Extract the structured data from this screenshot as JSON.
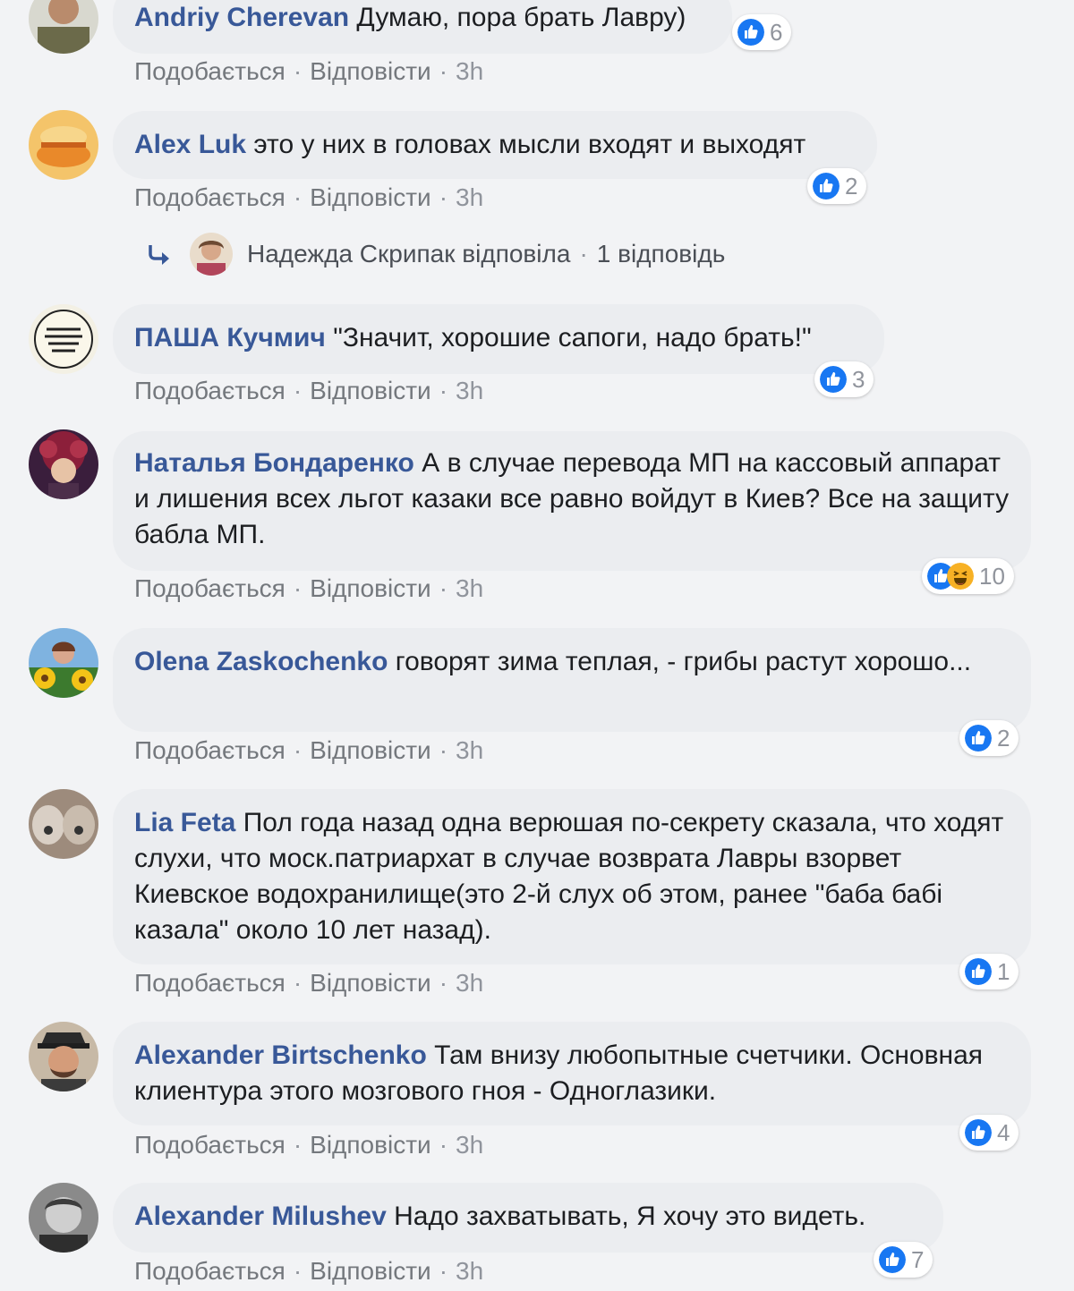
{
  "strings": {
    "like": "Подобається",
    "reply": "Відповісти",
    "dot": "·",
    "time": "3h"
  },
  "comments": [
    {
      "author": "Andriy Cherevan",
      "text": "Думаю, пора брать Лавру)",
      "reaction_count": "6",
      "reactions": [
        "like"
      ]
    },
    {
      "author": "Alex Luk",
      "text": "это у них в головах мысли входят и выходят",
      "reaction_count": "2",
      "reactions": [
        "like"
      ]
    },
    {
      "author": "ПАША Кучмич",
      "text": "\"Значит, хорошие сапоги, надо брать!\"",
      "reaction_count": "3",
      "reactions": [
        "like"
      ]
    },
    {
      "author": "Наталья Бондаренко",
      "text": "А в случае перевода МП на кассовый аппарат и лишения всех льгот казаки все равно войдут в Киев? Все на защиту бабла МП.",
      "reaction_count": "10",
      "reactions": [
        "like",
        "haha"
      ]
    },
    {
      "author": "Olena Zaskochenko",
      "text": "говорят зима теплая, - грибы растут хорошо...",
      "reaction_count": "2",
      "reactions": [
        "like"
      ]
    },
    {
      "author": "Lia Feta",
      "text": "Пол года назад одна верюшая по-секрету сказала, что ходят слухи, что моск.патриархат в случае возврата Лавры взорвет Киевское водохранилище(это 2-й слух об этом, ранее \"баба бабі казала\" около 10 лет назад).",
      "reaction_count": "1",
      "reactions": [
        "like"
      ]
    },
    {
      "author": "Alexander Birtschenko",
      "text": "Там внизу любопытные счетчики. Основная клиентура этого мозгового гноя - Одноглазики.",
      "reaction_count": "4",
      "reactions": [
        "like"
      ]
    },
    {
      "author": "Alexander Milushev",
      "text": "Надо захватывать, Я хочу это видеть.",
      "reaction_count": "7",
      "reactions": [
        "like"
      ]
    }
  ],
  "reply_thread": {
    "replier": "Надежда Скрипак відповіла",
    "count_label": "1 відповідь"
  },
  "colors": {
    "background": "#f2f3f5",
    "bubble": "#ebedf0",
    "author": "#385898",
    "muted": "#90949c",
    "like_blue": "#1877f2",
    "haha_yellow": "#f7b125"
  }
}
